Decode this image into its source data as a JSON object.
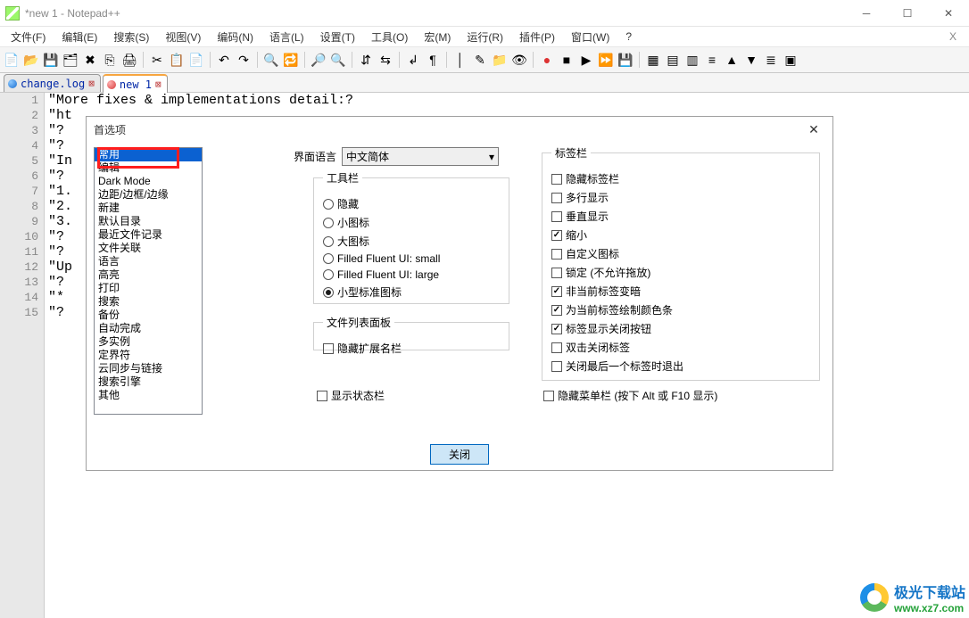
{
  "title": "*new 1 - Notepad++",
  "menu": [
    "文件(F)",
    "编辑(E)",
    "搜索(S)",
    "视图(V)",
    "编码(N)",
    "语言(L)",
    "设置(T)",
    "工具(O)",
    "宏(M)",
    "运行(R)",
    "插件(P)",
    "窗口(W)",
    "?"
  ],
  "tabs": [
    {
      "label": "change.log",
      "active": false,
      "dirty": false
    },
    {
      "label": "new 1",
      "active": true,
      "dirty": true
    }
  ],
  "editor": {
    "gutter": "1\n2\n3\n4\n5\n6\n7\n8\n9\n10\n11\n12\n13\n14\n15",
    "lines": [
      "\"More fixes & implementations detail:?",
      "\"ht",
      "\"?",
      "\"?",
      "\"In",
      "\"?",
      "\"1.",
      "\"2.",
      "\"3.",
      "\"?",
      "\"?",
      "\"Up",
      "\"?",
      "\"*",
      "\"?"
    ]
  },
  "dialog": {
    "title": "首选项",
    "list": [
      "常用",
      "编辑",
      "Dark Mode",
      "边距/边框/边缘",
      "新建",
      "默认目录",
      "最近文件记录",
      "文件关联",
      "语言",
      "高亮",
      "打印",
      "搜索",
      "备份",
      "自动完成",
      "多实例",
      "定界符",
      "云同步与链接",
      "搜索引擎",
      "其他"
    ],
    "selected_index": 0,
    "language_label": "界面语言",
    "language_value": "中文简体",
    "toolbar_group": {
      "legend": "工具栏",
      "options": [
        {
          "type": "radio",
          "label": "隐藏",
          "selected": false
        },
        {
          "type": "radio",
          "label": "小图标",
          "selected": false
        },
        {
          "type": "radio",
          "label": "大图标",
          "selected": false
        },
        {
          "type": "radio",
          "label": "Filled Fluent UI: small",
          "selected": false
        },
        {
          "type": "radio",
          "label": "Filled Fluent UI: large",
          "selected": false
        },
        {
          "type": "radio",
          "label": "小型标准图标",
          "selected": true
        }
      ]
    },
    "filelist_group": {
      "legend": "文件列表面板",
      "options": [
        {
          "type": "chk",
          "label": "隐藏扩展名栏",
          "selected": false
        }
      ]
    },
    "tabbar_group": {
      "legend": "标签栏",
      "options": [
        {
          "type": "chk",
          "label": "隐藏标签栏",
          "selected": false
        },
        {
          "type": "chk",
          "label": "多行显示",
          "selected": false
        },
        {
          "type": "chk",
          "label": "垂直显示",
          "selected": false
        },
        {
          "type": "chk",
          "label": "缩小",
          "selected": true
        },
        {
          "type": "chk",
          "label": "自定义图标",
          "selected": false
        },
        {
          "type": "chk",
          "label": "锁定 (不允许拖放)",
          "selected": false
        },
        {
          "type": "chk",
          "label": "非当前标签变暗",
          "selected": true
        },
        {
          "type": "chk",
          "label": "为当前标签绘制颜色条",
          "selected": true
        },
        {
          "type": "chk",
          "label": "标签显示关闭按钮",
          "selected": true
        },
        {
          "type": "chk",
          "label": "双击关闭标签",
          "selected": false
        },
        {
          "type": "chk",
          "label": "关闭最后一个标签时退出",
          "selected": false
        }
      ]
    },
    "show_statusbar": {
      "label": "显示状态栏",
      "selected": false
    },
    "hide_menubar": {
      "label": "隐藏菜单栏 (按下 Alt 或 F10 显示)",
      "selected": false
    },
    "close_btn": "关闭"
  },
  "watermark": {
    "main": "极光下载站",
    "sub": "www.xz7.com"
  }
}
